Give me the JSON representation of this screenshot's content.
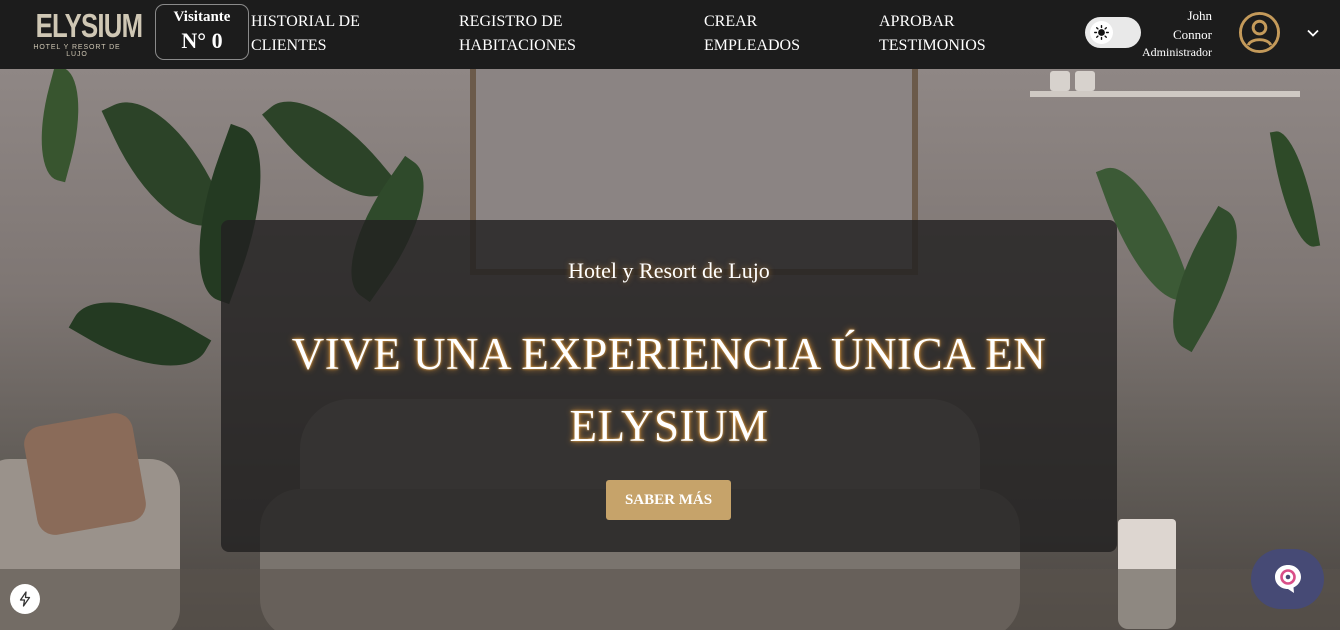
{
  "brand": {
    "name": "ELYSIUM",
    "tagline": "HOTEL Y RESORT DE LUJO"
  },
  "visitor": {
    "label": "Visitante",
    "count": "N° 0"
  },
  "nav": {
    "historial": [
      "HISTORIAL DE",
      "CLIENTES"
    ],
    "registro": [
      "REGISTRO DE",
      "HABITACIONES"
    ],
    "crear": [
      "CREAR",
      "EMPLEADOS"
    ],
    "aprobar": [
      "APROBAR",
      "TESTIMONIOS"
    ]
  },
  "theme_toggle": {
    "icon": "sun-icon"
  },
  "user": {
    "first_name": "John",
    "last_name": "Connor",
    "role": "Administrador"
  },
  "hero": {
    "subtitle": "Hotel y Resort de Lujo",
    "headline_line1": "VIVE UNA EXPERIENCIA ÚNICA EN",
    "headline_line2": "ELYSIUM",
    "cta_label": "SABER MÁS"
  },
  "colors": {
    "nav_bg": "#1c1c1c",
    "gold": "#c6a36a",
    "chat_bg": "#464a75"
  }
}
